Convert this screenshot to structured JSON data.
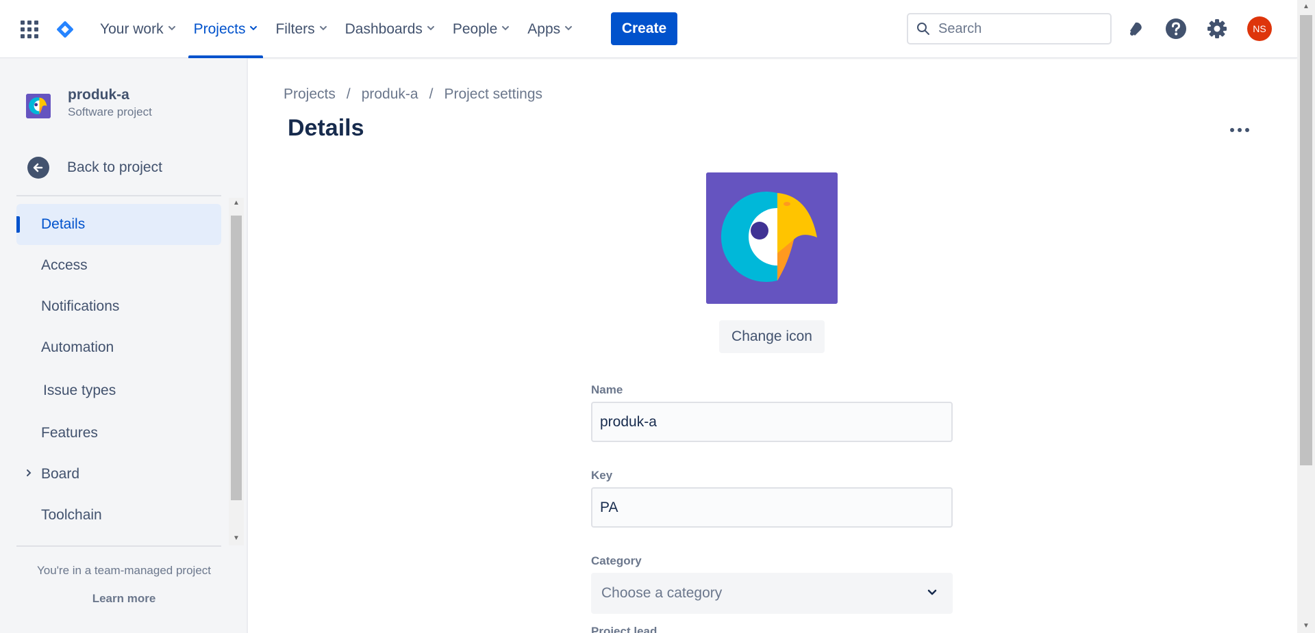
{
  "topnav": {
    "items": [
      {
        "label": "Your work",
        "active": false
      },
      {
        "label": "Projects",
        "active": true
      },
      {
        "label": "Filters",
        "active": false
      },
      {
        "label": "Dashboards",
        "active": false
      },
      {
        "label": "People",
        "active": false
      },
      {
        "label": "Apps",
        "active": false
      }
    ],
    "create_label": "Create",
    "search_placeholder": "Search",
    "avatar_initials": "NS",
    "icons": [
      "app-switcher-icon",
      "jira-logo-icon",
      "notifications-icon",
      "help-icon",
      "settings-icon"
    ],
    "colors": {
      "accent": "#0052cc",
      "avatar": "#de350b"
    }
  },
  "sidebar": {
    "project_name": "produk-a",
    "project_type": "Software project",
    "back_label": "Back to project",
    "items": [
      {
        "label": "Details",
        "active": true,
        "expandable": false
      },
      {
        "label": "Access",
        "active": false,
        "expandable": false
      },
      {
        "label": "Notifications",
        "active": false,
        "expandable": false
      },
      {
        "label": "Automation",
        "active": false,
        "expandable": false
      },
      {
        "label": "Issue types",
        "active": false,
        "expandable": false
      },
      {
        "label": "Features",
        "active": false,
        "expandable": false
      },
      {
        "label": "Board",
        "active": false,
        "expandable": true
      },
      {
        "label": "Toolchain",
        "active": false,
        "expandable": false
      }
    ],
    "footer_text": "You're in a team-managed project",
    "footer_link": "Learn more"
  },
  "main": {
    "breadcrumb": [
      "Projects",
      "produk-a",
      "Project settings"
    ],
    "title": "Details",
    "change_icon_label": "Change icon",
    "fields": {
      "name_label": "Name",
      "name_value": "produk-a",
      "key_label": "Key",
      "key_value": "PA",
      "category_label": "Category",
      "category_placeholder": "Choose a category",
      "project_lead_label": "Project lead"
    }
  }
}
